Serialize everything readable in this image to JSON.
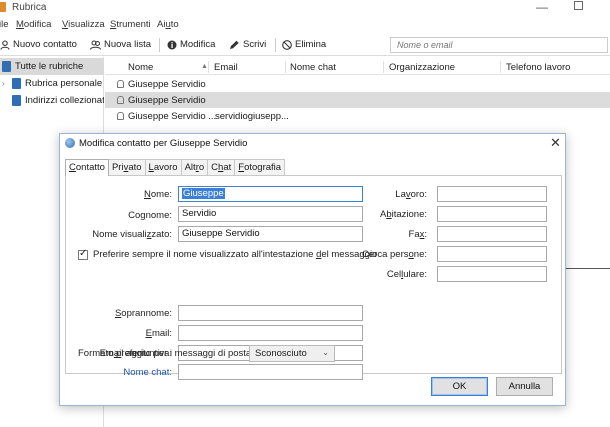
{
  "window": {
    "title": "Rubrica"
  },
  "menu": {
    "items": [
      "ile",
      "Modifica",
      "Visualizza",
      "Strumenti",
      "Aiuto"
    ]
  },
  "toolbar": {
    "new_contact": "Nuovo contatto",
    "new_list": "Nuova lista",
    "edit": "Modifica",
    "write": "Scrivi",
    "delete": "Elimina",
    "search_placeholder": "Nome o email"
  },
  "sidebar": {
    "items": [
      {
        "label": "Tutte le rubriche",
        "selected": true
      },
      {
        "label": "Rubrica personale"
      },
      {
        "label": "Indirizzi collezionati"
      }
    ]
  },
  "table": {
    "columns": [
      "Nome",
      "Email",
      "Nome chat",
      "Organizzazione",
      "Telefono lavoro"
    ],
    "rows": [
      {
        "name": "Giuseppe Servidio",
        "email": ""
      },
      {
        "name": "Giuseppe Servidio",
        "email": "",
        "selected": true
      },
      {
        "name": "Giuseppe Servidio ...",
        "email": "servidiogiusepp..."
      }
    ]
  },
  "dialog": {
    "title": "Modifica contatto per Giuseppe Servidio",
    "tabs": [
      "Contatto",
      "Privato",
      "Lavoro",
      "Altro",
      "Chat",
      "Fotografia"
    ],
    "fields": {
      "nome": {
        "label": "Nome:",
        "value": "Giuseppe"
      },
      "cognome": {
        "label": "Cognome:",
        "value": "Servidio"
      },
      "nome_visualizzato": {
        "label": "Nome visualizzato:",
        "value": "Giuseppe Servidio"
      },
      "soprannome": {
        "label": "Soprannome:",
        "value": ""
      },
      "email": {
        "label": "Email:",
        "value": ""
      },
      "email_aggiuntiva": {
        "label": "Email aggiuntiva:",
        "value": ""
      },
      "nome_chat": {
        "label": "Nome chat:",
        "value": ""
      },
      "lavoro": {
        "label": "Lavoro:",
        "value": ""
      },
      "abitazione": {
        "label": "Abitazione:",
        "value": ""
      },
      "fax": {
        "label": "Fax:",
        "value": ""
      },
      "cerca_persone": {
        "label": "Cerca persone:",
        "value": ""
      },
      "cellulare": {
        "label": "Cellulare:",
        "value": ""
      }
    },
    "prefer_display_name": {
      "label": "Preferire sempre il nome visualizzato all'intestazione del messaggio",
      "checked": true
    },
    "format": {
      "label": "Formato preferito per i messaggi di posta:",
      "value": "Sconosciuto"
    },
    "ok_label": "OK",
    "cancel_label": "Annulla"
  }
}
